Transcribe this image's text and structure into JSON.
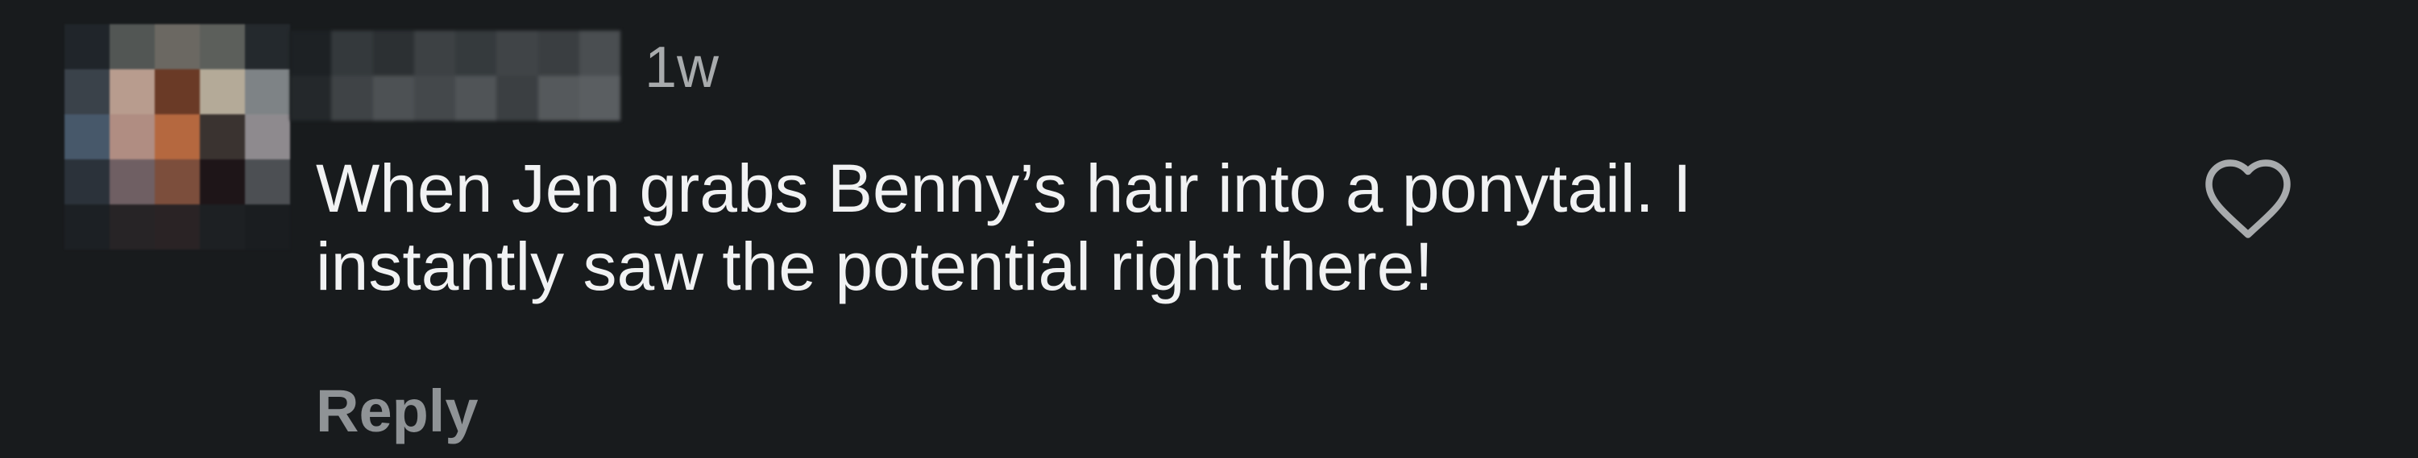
{
  "comment": {
    "timestamp": "1w",
    "text": "When Jen grabs Benny’s hair into a ponytail. I\ninstantly saw the potential right there!",
    "reply_label": "Reply",
    "like_icon": "heart-outline-icon"
  },
  "colors": {
    "background": "#181b1d",
    "text": "#f1f2f3",
    "muted": "#a8abad",
    "reply": "#8f9396"
  }
}
